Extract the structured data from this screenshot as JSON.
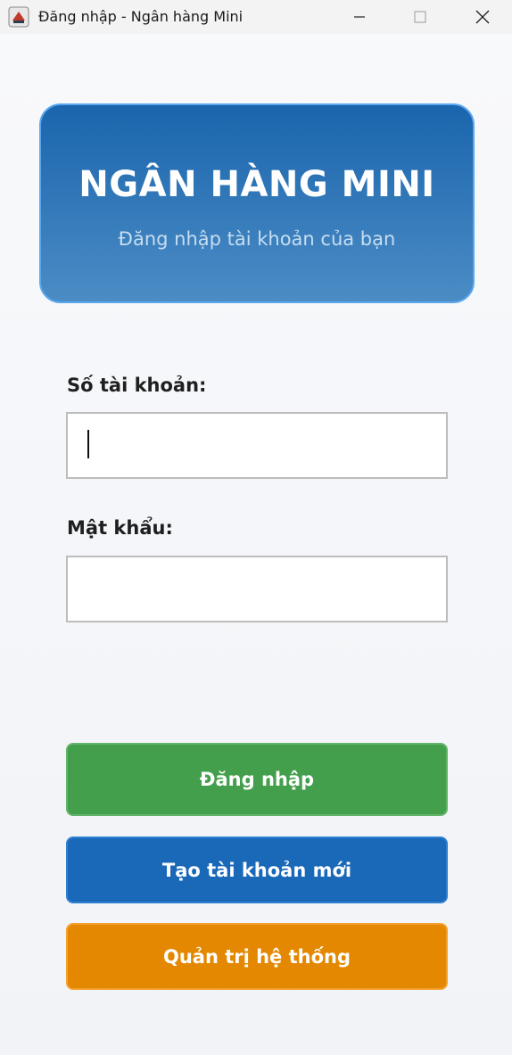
{
  "window": {
    "title": "Đăng nhập - Ngân hàng Mini",
    "app_icon": "java-app-icon",
    "controls": [
      "minimize-icon",
      "maximize-icon",
      "close-icon"
    ]
  },
  "header": {
    "title": "NGÂN HÀNG MINI",
    "subtitle": "Đăng nhập tài khoản của bạn"
  },
  "form": {
    "account_label": "Số tài khoản:",
    "account_value": "",
    "password_label": "Mật khẩu:",
    "password_value": ""
  },
  "buttons": {
    "login": "Đăng nhập",
    "create_account": "Tạo tài khoản mới",
    "admin": "Quản trị hệ thống"
  },
  "colors": {
    "header_top": "#1a65ad",
    "header_bottom": "#4b8cc5",
    "login_button": "#449f4c",
    "create_button": "#1a69b8",
    "admin_button": "#e38800"
  }
}
